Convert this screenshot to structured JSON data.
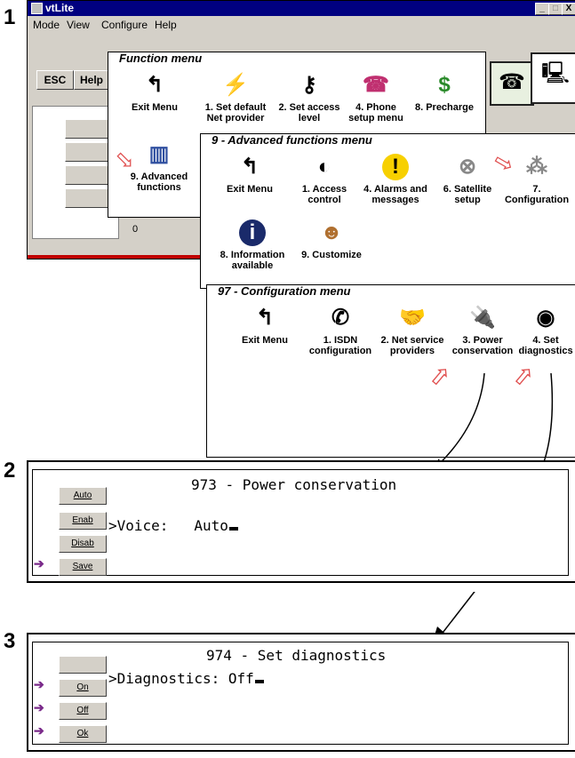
{
  "steps": {
    "s1": "1",
    "s2": "2",
    "s3": "3"
  },
  "window": {
    "title": "vtLite",
    "controls": {
      "minimize": "_",
      "maximize": "□",
      "close": "X"
    },
    "menubar": [
      "Mode",
      "View",
      "Configure",
      "Help"
    ],
    "toolbar": {
      "esc": "ESC",
      "help": "Help"
    },
    "counter": "0"
  },
  "function_menu": {
    "title": "Function menu",
    "items": [
      {
        "label_1": "Exit Menu",
        "label_2": "",
        "icon": "exit-arrow-icon"
      },
      {
        "label_1": "1. Set default",
        "label_2": "Net provider",
        "icon": "network-tower-icon"
      },
      {
        "label_1": "2. Set access",
        "label_2": "level",
        "icon": "keys-icon"
      },
      {
        "label_1": "4. Phone",
        "label_2": "setup menu",
        "icon": "telephone-icon"
      },
      {
        "label_1": "8. Precharge",
        "label_2": "",
        "icon": "money-bag-icon"
      },
      {
        "label_1": "9. Advanced",
        "label_2": "functions",
        "icon": "books-icon"
      }
    ]
  },
  "advanced_menu": {
    "title": "9 - Advanced functions menu",
    "items": [
      {
        "label_1": "Exit Menu",
        "label_2": "",
        "icon": "exit-arrow-icon"
      },
      {
        "label_1": "1. Access",
        "label_2": "control",
        "icon": "ear-icon"
      },
      {
        "label_1": "4. Alarms and",
        "label_2": "messages",
        "icon": "exclamation-icon"
      },
      {
        "label_1": "6. Satellite",
        "label_2": "setup",
        "icon": "satellite-icon"
      },
      {
        "label_1": "7.",
        "label_2": "Configuration",
        "icon": "configuration-icon"
      },
      {
        "label_1": "8. Information",
        "label_2": "available",
        "icon": "info-icon"
      },
      {
        "label_1": "9. Customize",
        "label_2": "",
        "icon": "people-icon"
      }
    ]
  },
  "config_menu": {
    "title": "97 - Configuration menu",
    "items": [
      {
        "label_1": "Exit Menu",
        "label_2": "",
        "icon": "exit-arrow-icon"
      },
      {
        "label_1": "1. ISDN",
        "label_2": "configuration",
        "icon": "handset-icon"
      },
      {
        "label_1": "2. Net service",
        "label_2": "providers",
        "icon": "handshake-icon"
      },
      {
        "label_1": "3. Power",
        "label_2": "conservation",
        "icon": "power-plug-icon"
      },
      {
        "label_1": "4. Set",
        "label_2": "diagnostics",
        "icon": "eye-icon"
      }
    ]
  },
  "power_panel": {
    "title": "973 - Power conservation",
    "line": ">Voice:   Auto",
    "buttons": [
      "Auto",
      "Enab",
      "Disab",
      "Save"
    ]
  },
  "diag_panel": {
    "title": "974 - Set diagnostics",
    "line": ">Diagnostics: Off",
    "buttons": [
      "",
      "On",
      "Off",
      "Ok"
    ]
  }
}
